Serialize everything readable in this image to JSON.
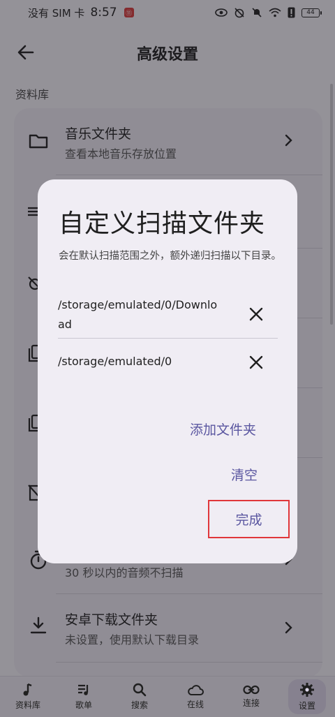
{
  "status_bar": {
    "carrier": "没有 SIM 卡",
    "time": "8:57",
    "badge": "⑪",
    "battery": "44"
  },
  "header": {
    "title": "高级设置"
  },
  "section": {
    "label": "资料库"
  },
  "list": {
    "items": [
      {
        "title": "音乐文件夹",
        "subtitle": "查看本地音乐存放位置",
        "icon": "folder-icon"
      },
      {
        "title": "",
        "subtitle": "30 秒以内的音频不扫描",
        "icon": "timer-icon"
      },
      {
        "title": "安卓下载文件夹",
        "subtitle": "未设置，使用默认下载目录",
        "icon": "download-icon"
      }
    ]
  },
  "dialog": {
    "title": "自定义扫描文件夹",
    "description": "会在默认扫描范围之外，额外递归扫描以下目录。",
    "folders": [
      {
        "path": "/storage/emulated/0/Download"
      },
      {
        "path": "/storage/emulated/0"
      }
    ],
    "add_label": "添加文件夹",
    "clear_label": "清空",
    "done_label": "完成"
  },
  "bottom_nav": {
    "items": [
      {
        "label": "资料库",
        "icon": "music-note-icon"
      },
      {
        "label": "歌单",
        "icon": "playlist-icon"
      },
      {
        "label": "搜索",
        "icon": "search-icon"
      },
      {
        "label": "在线",
        "icon": "cloud-icon"
      },
      {
        "label": "连接",
        "icon": "link-icon"
      },
      {
        "label": "设置",
        "icon": "gear-icon",
        "active": true
      }
    ]
  },
  "colors": {
    "accent": "#5a56a0",
    "highlight_box": "#e0363a",
    "dialog_bg": "#f0edf4"
  }
}
